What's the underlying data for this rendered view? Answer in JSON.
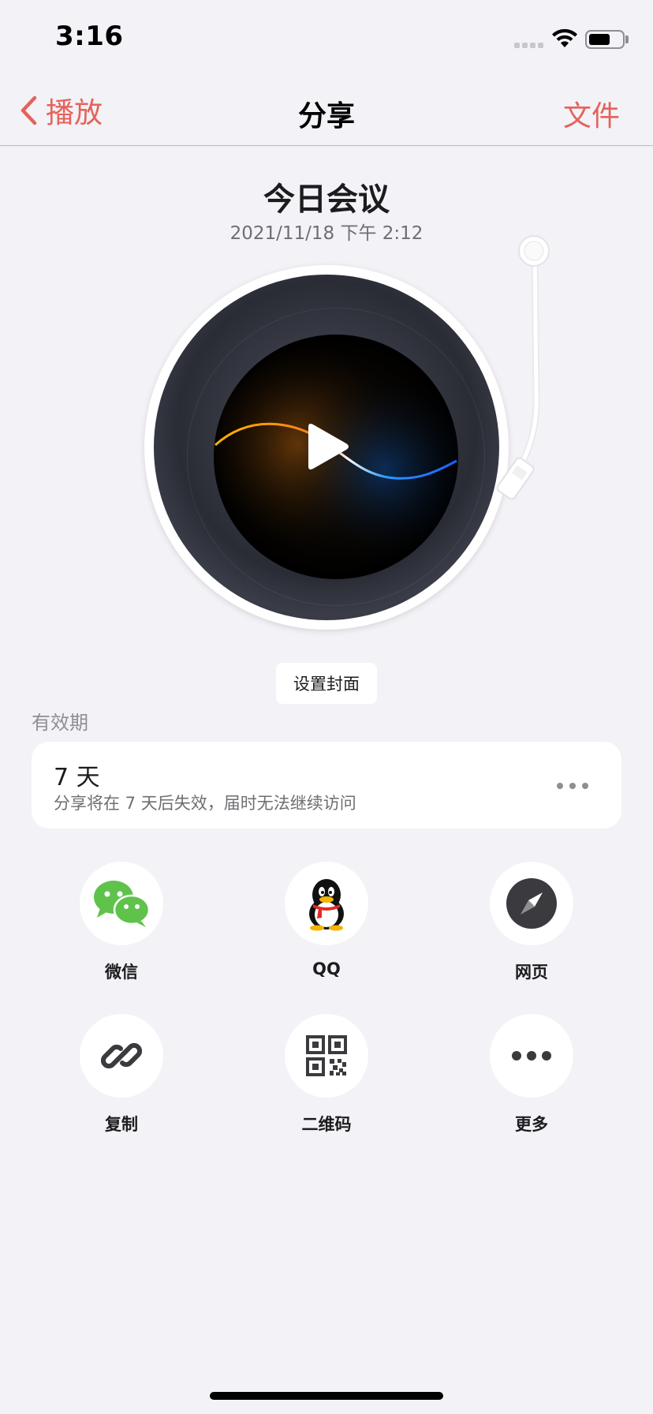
{
  "status_bar": {
    "time": "3:16"
  },
  "nav": {
    "back_label": "播放",
    "title": "分享",
    "right_label": "文件"
  },
  "recording": {
    "title": "今日会议",
    "date": "2021/11/18 下午 2:12"
  },
  "cover_button": "设置封面",
  "expiry": {
    "section_label": "有效期",
    "value": "7 天",
    "description": "分享将在 7 天后失效，届时无法继续访问"
  },
  "share_targets": [
    {
      "label": "微信",
      "icon": "wechat-icon"
    },
    {
      "label": "QQ",
      "icon": "qq-icon"
    },
    {
      "label": "网页",
      "icon": "compass-icon"
    },
    {
      "label": "复制",
      "icon": "link-icon"
    },
    {
      "label": "二维码",
      "icon": "qr-code-icon"
    },
    {
      "label": "更多",
      "icon": "more-icon"
    }
  ],
  "colors": {
    "accent": "#e5625a",
    "background": "#f2f2f7",
    "wechat_green": "#5fc34b"
  }
}
